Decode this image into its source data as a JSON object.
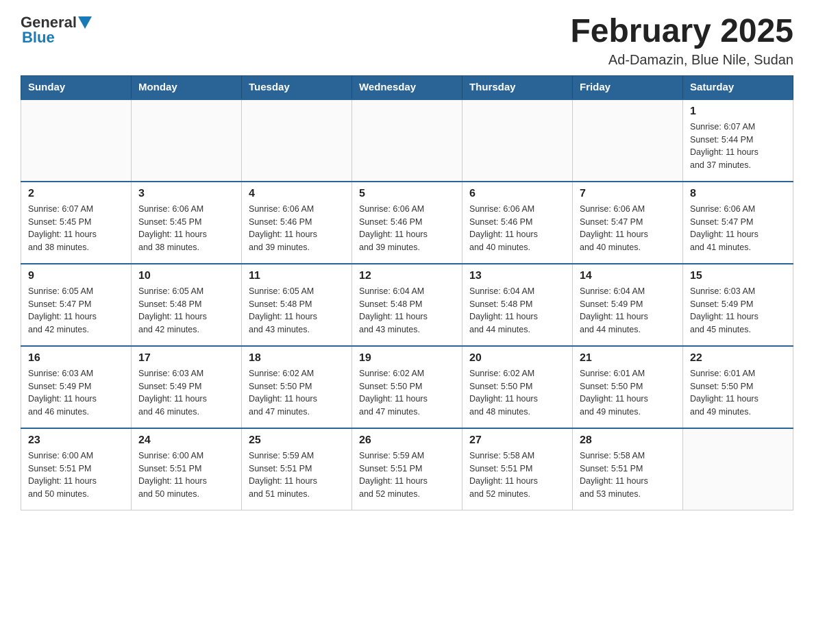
{
  "logo": {
    "general": "General",
    "blue": "Blue"
  },
  "title": "February 2025",
  "subtitle": "Ad-Damazin, Blue Nile, Sudan",
  "weekdays": [
    "Sunday",
    "Monday",
    "Tuesday",
    "Wednesday",
    "Thursday",
    "Friday",
    "Saturday"
  ],
  "weeks": [
    [
      {
        "day": "",
        "info": ""
      },
      {
        "day": "",
        "info": ""
      },
      {
        "day": "",
        "info": ""
      },
      {
        "day": "",
        "info": ""
      },
      {
        "day": "",
        "info": ""
      },
      {
        "day": "",
        "info": ""
      },
      {
        "day": "1",
        "info": "Sunrise: 6:07 AM\nSunset: 5:44 PM\nDaylight: 11 hours\nand 37 minutes."
      }
    ],
    [
      {
        "day": "2",
        "info": "Sunrise: 6:07 AM\nSunset: 5:45 PM\nDaylight: 11 hours\nand 38 minutes."
      },
      {
        "day": "3",
        "info": "Sunrise: 6:06 AM\nSunset: 5:45 PM\nDaylight: 11 hours\nand 38 minutes."
      },
      {
        "day": "4",
        "info": "Sunrise: 6:06 AM\nSunset: 5:46 PM\nDaylight: 11 hours\nand 39 minutes."
      },
      {
        "day": "5",
        "info": "Sunrise: 6:06 AM\nSunset: 5:46 PM\nDaylight: 11 hours\nand 39 minutes."
      },
      {
        "day": "6",
        "info": "Sunrise: 6:06 AM\nSunset: 5:46 PM\nDaylight: 11 hours\nand 40 minutes."
      },
      {
        "day": "7",
        "info": "Sunrise: 6:06 AM\nSunset: 5:47 PM\nDaylight: 11 hours\nand 40 minutes."
      },
      {
        "day": "8",
        "info": "Sunrise: 6:06 AM\nSunset: 5:47 PM\nDaylight: 11 hours\nand 41 minutes."
      }
    ],
    [
      {
        "day": "9",
        "info": "Sunrise: 6:05 AM\nSunset: 5:47 PM\nDaylight: 11 hours\nand 42 minutes."
      },
      {
        "day": "10",
        "info": "Sunrise: 6:05 AM\nSunset: 5:48 PM\nDaylight: 11 hours\nand 42 minutes."
      },
      {
        "day": "11",
        "info": "Sunrise: 6:05 AM\nSunset: 5:48 PM\nDaylight: 11 hours\nand 43 minutes."
      },
      {
        "day": "12",
        "info": "Sunrise: 6:04 AM\nSunset: 5:48 PM\nDaylight: 11 hours\nand 43 minutes."
      },
      {
        "day": "13",
        "info": "Sunrise: 6:04 AM\nSunset: 5:48 PM\nDaylight: 11 hours\nand 44 minutes."
      },
      {
        "day": "14",
        "info": "Sunrise: 6:04 AM\nSunset: 5:49 PM\nDaylight: 11 hours\nand 44 minutes."
      },
      {
        "day": "15",
        "info": "Sunrise: 6:03 AM\nSunset: 5:49 PM\nDaylight: 11 hours\nand 45 minutes."
      }
    ],
    [
      {
        "day": "16",
        "info": "Sunrise: 6:03 AM\nSunset: 5:49 PM\nDaylight: 11 hours\nand 46 minutes."
      },
      {
        "day": "17",
        "info": "Sunrise: 6:03 AM\nSunset: 5:49 PM\nDaylight: 11 hours\nand 46 minutes."
      },
      {
        "day": "18",
        "info": "Sunrise: 6:02 AM\nSunset: 5:50 PM\nDaylight: 11 hours\nand 47 minutes."
      },
      {
        "day": "19",
        "info": "Sunrise: 6:02 AM\nSunset: 5:50 PM\nDaylight: 11 hours\nand 47 minutes."
      },
      {
        "day": "20",
        "info": "Sunrise: 6:02 AM\nSunset: 5:50 PM\nDaylight: 11 hours\nand 48 minutes."
      },
      {
        "day": "21",
        "info": "Sunrise: 6:01 AM\nSunset: 5:50 PM\nDaylight: 11 hours\nand 49 minutes."
      },
      {
        "day": "22",
        "info": "Sunrise: 6:01 AM\nSunset: 5:50 PM\nDaylight: 11 hours\nand 49 minutes."
      }
    ],
    [
      {
        "day": "23",
        "info": "Sunrise: 6:00 AM\nSunset: 5:51 PM\nDaylight: 11 hours\nand 50 minutes."
      },
      {
        "day": "24",
        "info": "Sunrise: 6:00 AM\nSunset: 5:51 PM\nDaylight: 11 hours\nand 50 minutes."
      },
      {
        "day": "25",
        "info": "Sunrise: 5:59 AM\nSunset: 5:51 PM\nDaylight: 11 hours\nand 51 minutes."
      },
      {
        "day": "26",
        "info": "Sunrise: 5:59 AM\nSunset: 5:51 PM\nDaylight: 11 hours\nand 52 minutes."
      },
      {
        "day": "27",
        "info": "Sunrise: 5:58 AM\nSunset: 5:51 PM\nDaylight: 11 hours\nand 52 minutes."
      },
      {
        "day": "28",
        "info": "Sunrise: 5:58 AM\nSunset: 5:51 PM\nDaylight: 11 hours\nand 53 minutes."
      },
      {
        "day": "",
        "info": ""
      }
    ]
  ]
}
